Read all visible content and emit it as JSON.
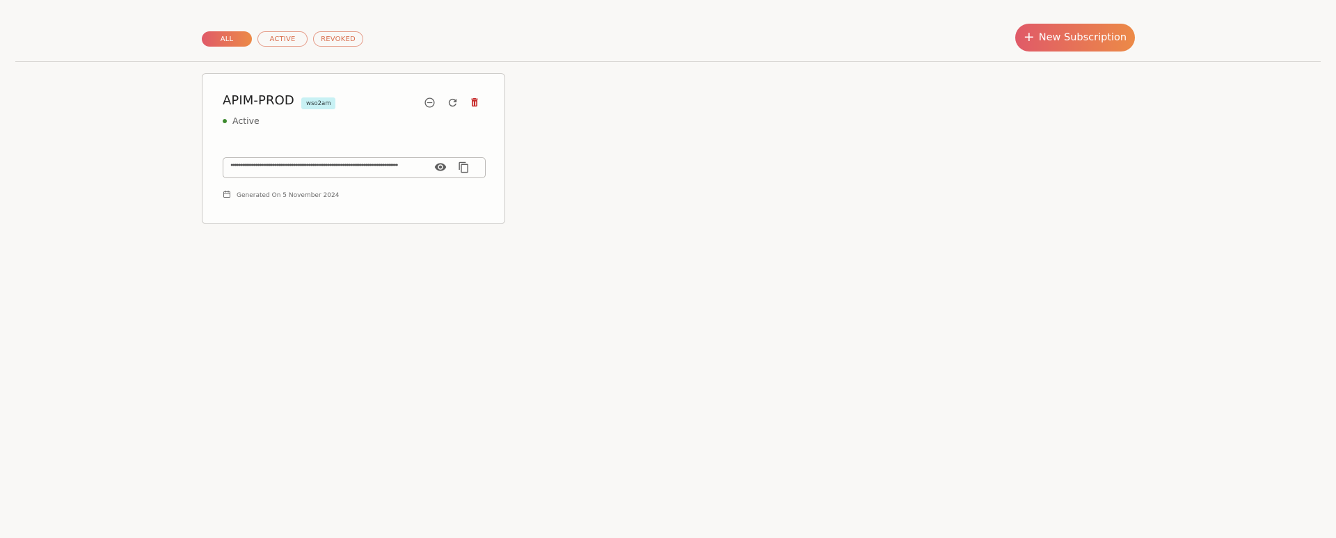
{
  "filters": {
    "all_label": "ALL",
    "active_label": "ACTIVE",
    "revoked_label": "REVOKED",
    "selected": "ALL"
  },
  "header": {
    "new_button_label": "New Subscription",
    "new_button_icon": "plus-icon"
  },
  "colors": {
    "accent_start": "#e05a68",
    "accent_end": "#ec8a47",
    "status_active": "#3d8a2f",
    "badge_bg": "#c8f1f4",
    "delete_red": "#c62828"
  },
  "subscription_card": {
    "title": "APIM-PROD",
    "badge": "wso2am",
    "status": "Active",
    "masked_key": "••••••••••••••••••••••••••••••••••••••••••••••••••••••••••••••••••••••••••••••••••••••••",
    "generated_text": "Generated On 5 November 2024",
    "action_icons": [
      "minus-circle-icon",
      "refresh-icon",
      "trash-icon"
    ],
    "key_icons": [
      "eye-icon",
      "copy-icon"
    ],
    "date_icon": "calendar-icon"
  }
}
